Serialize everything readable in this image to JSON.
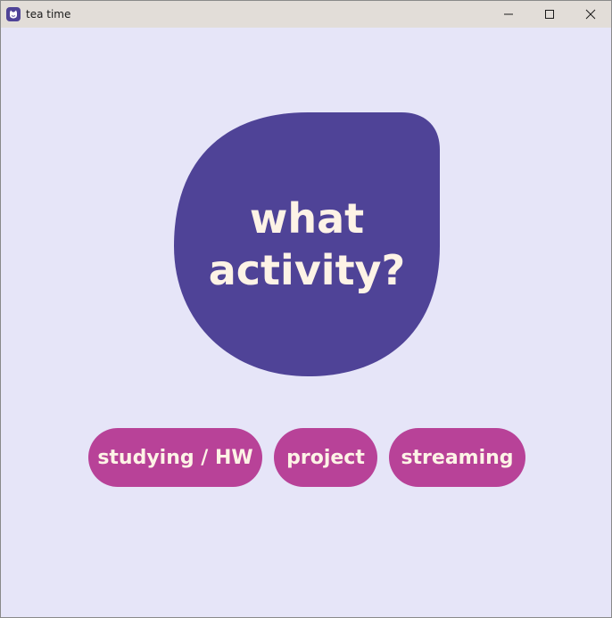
{
  "window": {
    "title": "tea time",
    "app_icon": "cat-face-icon"
  },
  "controls": {
    "minimize_icon": "minimize-icon",
    "maximize_icon": "maximize-icon",
    "close_icon": "close-icon"
  },
  "prompt": {
    "line1": "what",
    "line2": "activity?"
  },
  "activities": [
    {
      "label": "studying / HW"
    },
    {
      "label": "project"
    },
    {
      "label": "streaming"
    }
  ],
  "colors": {
    "background": "#e6e5f8",
    "blob": "#4f4397",
    "button": "#b84298",
    "text_light": "#fdf3e6",
    "titlebar": "#e2ddd8"
  }
}
